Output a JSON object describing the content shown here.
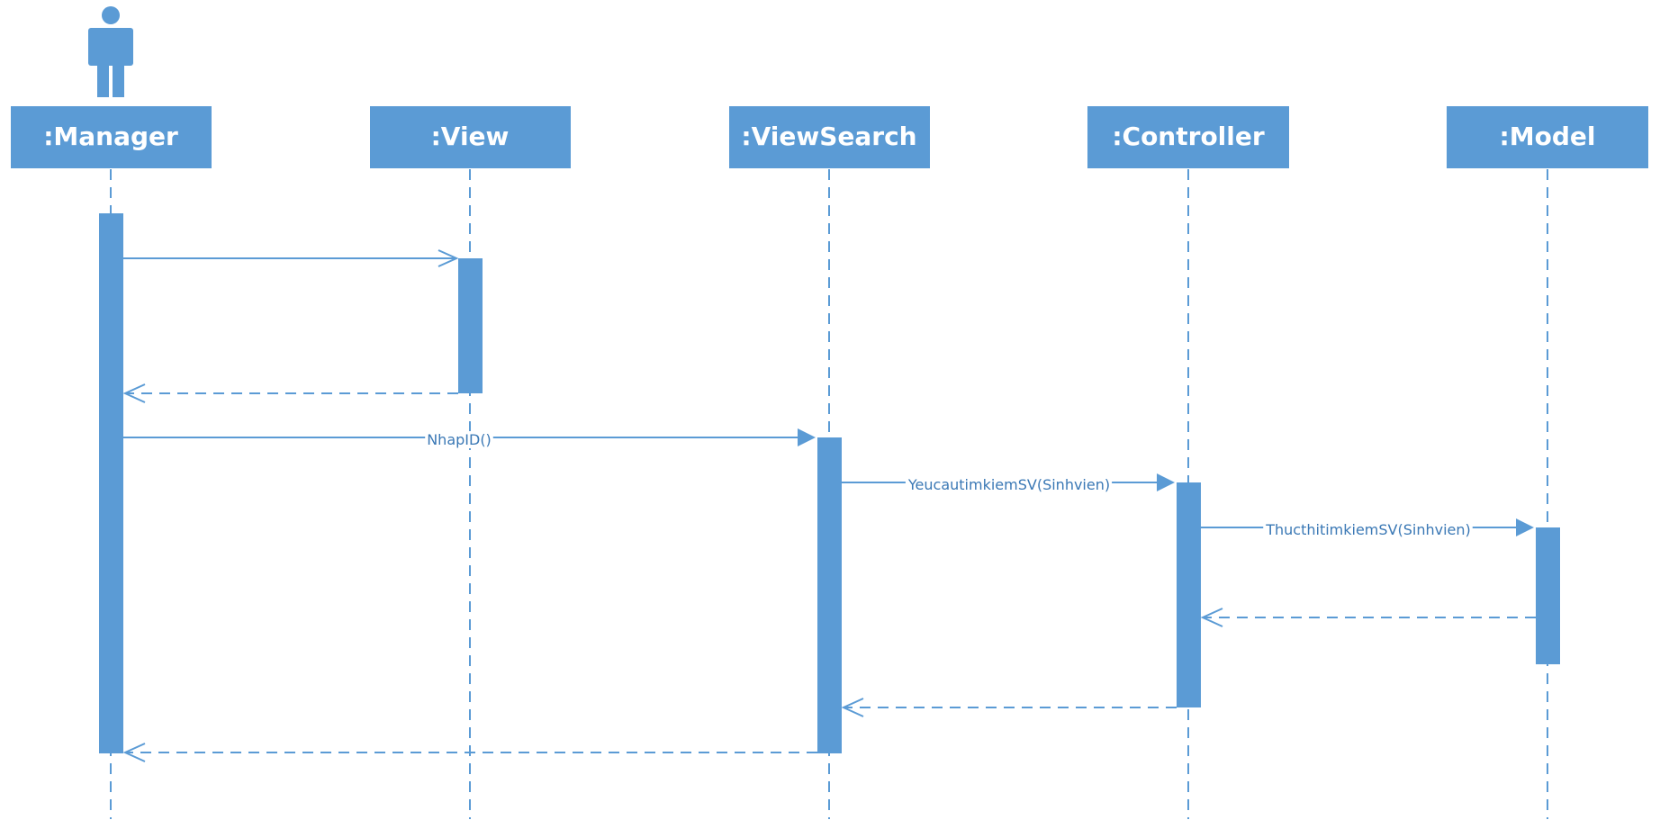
{
  "colors": {
    "accent": "#5b9bd5",
    "label_text": "#3a78b5",
    "header_text": "#ffffff"
  },
  "actor_icon": "person-icon",
  "lifelines": [
    {
      "id": "manager",
      "label": ":Manager"
    },
    {
      "id": "view",
      "label": ":View"
    },
    {
      "id": "viewsearch",
      "label": ":ViewSearch"
    },
    {
      "id": "controller",
      "label": ":Controller"
    },
    {
      "id": "model",
      "label": ":Model"
    }
  ],
  "messages": [
    {
      "from": "manager",
      "to": "view",
      "label": "",
      "kind": "call"
    },
    {
      "from": "view",
      "to": "manager",
      "label": "",
      "kind": "return"
    },
    {
      "from": "manager",
      "to": "viewsearch",
      "label": "NhapID()",
      "kind": "sync"
    },
    {
      "from": "viewsearch",
      "to": "controller",
      "label": "YeucautimkiemSV(Sinhvien)",
      "kind": "sync"
    },
    {
      "from": "controller",
      "to": "model",
      "label": "ThucthitimkiemSV(Sinhvien)",
      "kind": "sync"
    },
    {
      "from": "model",
      "to": "controller",
      "label": "",
      "kind": "return"
    },
    {
      "from": "controller",
      "to": "viewsearch",
      "label": "",
      "kind": "return"
    },
    {
      "from": "viewsearch",
      "to": "manager",
      "label": "",
      "kind": "return"
    }
  ]
}
